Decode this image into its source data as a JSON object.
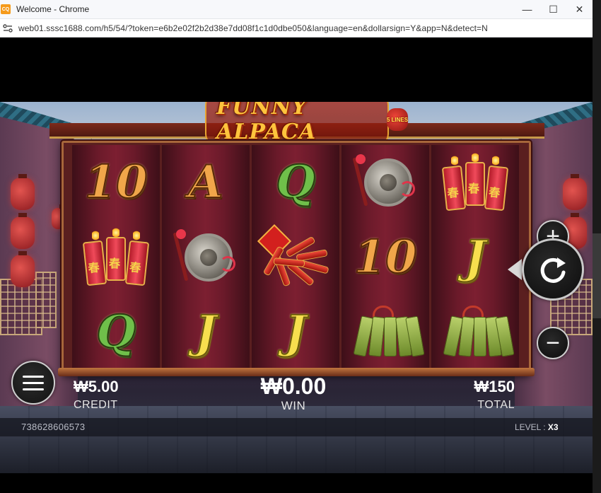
{
  "window": {
    "title": "Welcome - Chrome",
    "app_icon": "CQ"
  },
  "controls": {
    "minimize": "—",
    "maximize": "☐",
    "close": "✕"
  },
  "address": {
    "url": "web01.sssc1688.com/h5/54/?token=e6b2e02f2b2d38e7dd08f1c1d0dbe050&language=en&dollarsign=Y&app=N&detect=N"
  },
  "game": {
    "logo": "FUNNY ALPACA",
    "lines_badge": "5 LINES",
    "reels": [
      [
        "10",
        "firecrackers",
        "Q"
      ],
      [
        "A",
        "gong",
        "J"
      ],
      [
        "Q",
        "firecracker-bundle",
        "J"
      ],
      [
        "gong",
        "10",
        "jade-slips"
      ],
      [
        "firecrackers",
        "J",
        "jade-slips"
      ]
    ],
    "buttons": {
      "plus": "+",
      "minus": "−",
      "spin": "↻"
    },
    "credit": {
      "value": "₩5.00",
      "label": "CREDIT"
    },
    "win": {
      "value": "₩0.00",
      "label": "WIN"
    },
    "total": {
      "value": "₩150",
      "label": "TOTAL"
    },
    "round_id": "738628606573",
    "level": {
      "label": "LEVEL : ",
      "value": "X3"
    }
  },
  "colors": {
    "accent": "#f0a64a",
    "reel": "#6b1a2a",
    "frame": "#a6663a"
  }
}
